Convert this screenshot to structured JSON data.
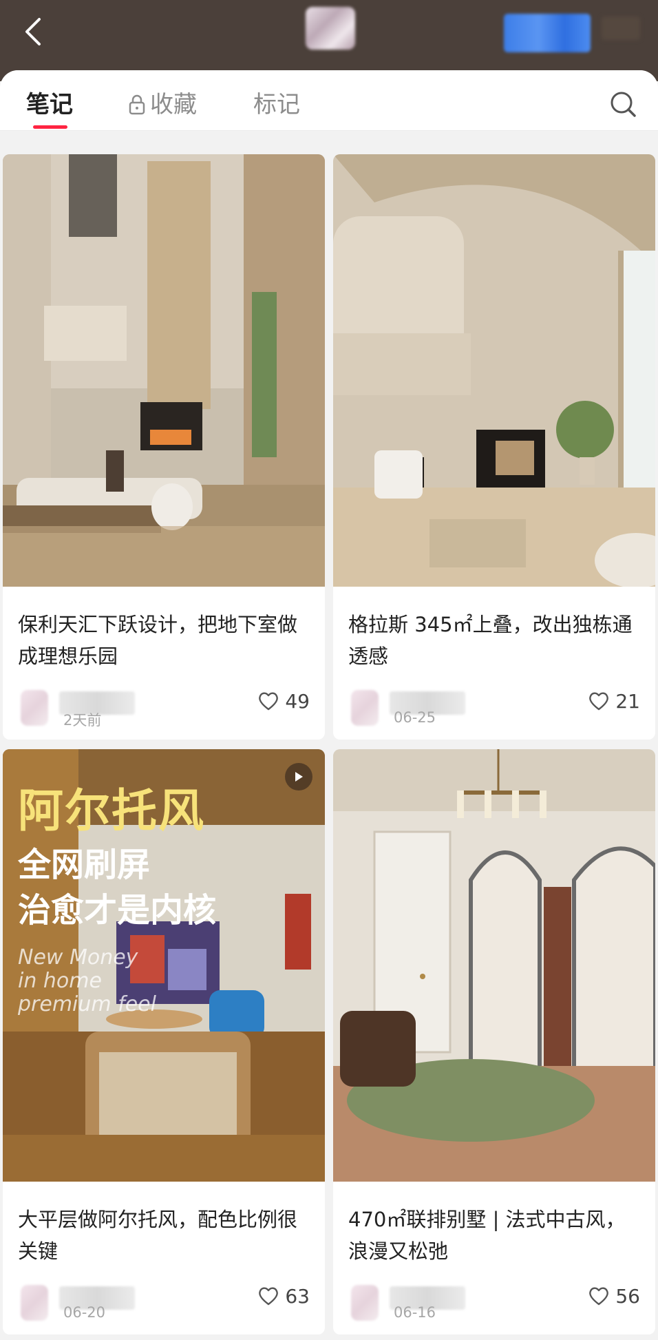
{
  "header": {
    "back_icon": "chevron-left-icon"
  },
  "tabs": [
    {
      "label": "笔记",
      "active": true
    },
    {
      "label": "收藏",
      "locked": true
    },
    {
      "label": "标记"
    }
  ],
  "notes": [
    {
      "title": "保利天汇下跃设计，把地下室做成理想乐园",
      "date": "2天前",
      "likes": "49"
    },
    {
      "title": "格拉斯 345㎡上叠，改出独栋通透感",
      "date": "06-25",
      "likes": "21"
    },
    {
      "title": "大平层做阿尔托风，配色比例很关键",
      "date": "06-20",
      "likes": "63",
      "overlay": {
        "line1": "阿尔托风",
        "line2": "全网刷屏",
        "line3": "治愈才是内核",
        "en1": "New Money",
        "en2": "in home",
        "en3": "premium feel"
      }
    },
    {
      "title": "470㎡联排别墅 | 法式中古风，浪漫又松弛",
      "date": "06-16",
      "likes": "56"
    }
  ],
  "colors": {
    "accent": "#ff2442",
    "header_bg": "#4b403a",
    "follow_blue": "#3d7ee8"
  }
}
